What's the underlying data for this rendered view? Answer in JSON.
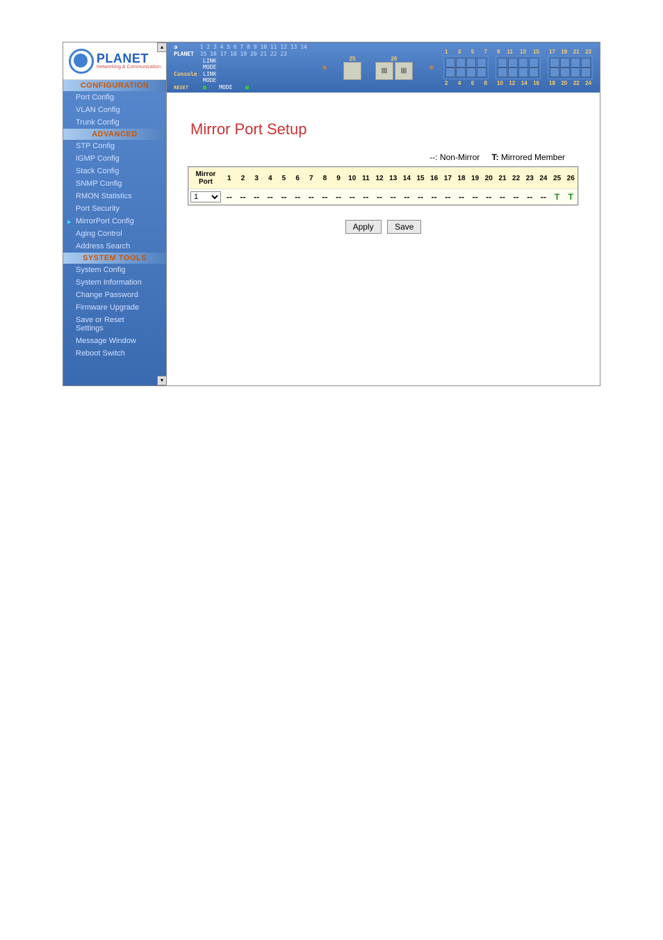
{
  "logo": {
    "name": "PLANET",
    "subtitle": "Networking & Communication"
  },
  "nav": {
    "sections": [
      {
        "header": "CONFIGURATION",
        "items": [
          "Port Config",
          "VLAN Config",
          "Trunk Config"
        ]
      },
      {
        "header": "ADVANCED",
        "items": [
          "STP Config",
          "IGMP Config",
          "Stack Config",
          "SNMP Config",
          "RMON Statistics",
          "Port Security",
          "MirrorPort Config",
          "Aging Control",
          "Address Search"
        ]
      },
      {
        "header": "SYSTEM TOOLS",
        "items": [
          "System Config",
          "System Information",
          "Change Password",
          "Firmware Upgrade",
          "Save or Reset Settings",
          "Message Window",
          "Reboot Switch"
        ]
      }
    ],
    "active": "MirrorPort Config"
  },
  "switch_panel": {
    "model_line1_nums": "1 2 3 4 5 6 7 8  9 10 11 12 13 14 15 16 17 18 19 20 21 22 23",
    "labels": {
      "link": "LINK",
      "mode": "MODE",
      "console": "Console",
      "reset": "RESET"
    },
    "slot_labels": [
      "25",
      "26"
    ],
    "port_tops": [
      [
        "1",
        "3",
        "5",
        "7"
      ],
      [
        "9",
        "11",
        "13",
        "15"
      ],
      [
        "17",
        "19",
        "21",
        "23"
      ]
    ],
    "port_bottoms": [
      [
        "2",
        "4",
        "6",
        "8"
      ],
      [
        "10",
        "12",
        "14",
        "16"
      ],
      [
        "18",
        "20",
        "22",
        "24"
      ]
    ]
  },
  "page": {
    "title": "Mirror Port Setup",
    "legend": {
      "nonmirror_key": "--:",
      "nonmirror_label": "Non-Mirror",
      "mirrored_key": "T:",
      "mirrored_label": "Mirrored Member"
    },
    "mirror_label": "Mirror Port",
    "ports": [
      "1",
      "2",
      "3",
      "4",
      "5",
      "6",
      "7",
      "8",
      "9",
      "10",
      "11",
      "12",
      "13",
      "14",
      "15",
      "16",
      "17",
      "18",
      "19",
      "20",
      "21",
      "22",
      "23",
      "24",
      "25",
      "26"
    ],
    "selected_port": "1",
    "status": [
      "--",
      "--",
      "--",
      "--",
      "--",
      "--",
      "--",
      "--",
      "--",
      "--",
      "--",
      "--",
      "--",
      "--",
      "--",
      "--",
      "--",
      "--",
      "--",
      "--",
      "--",
      "--",
      "--",
      "--",
      "T",
      "T"
    ],
    "buttons": {
      "apply": "Apply",
      "save": "Save"
    }
  }
}
